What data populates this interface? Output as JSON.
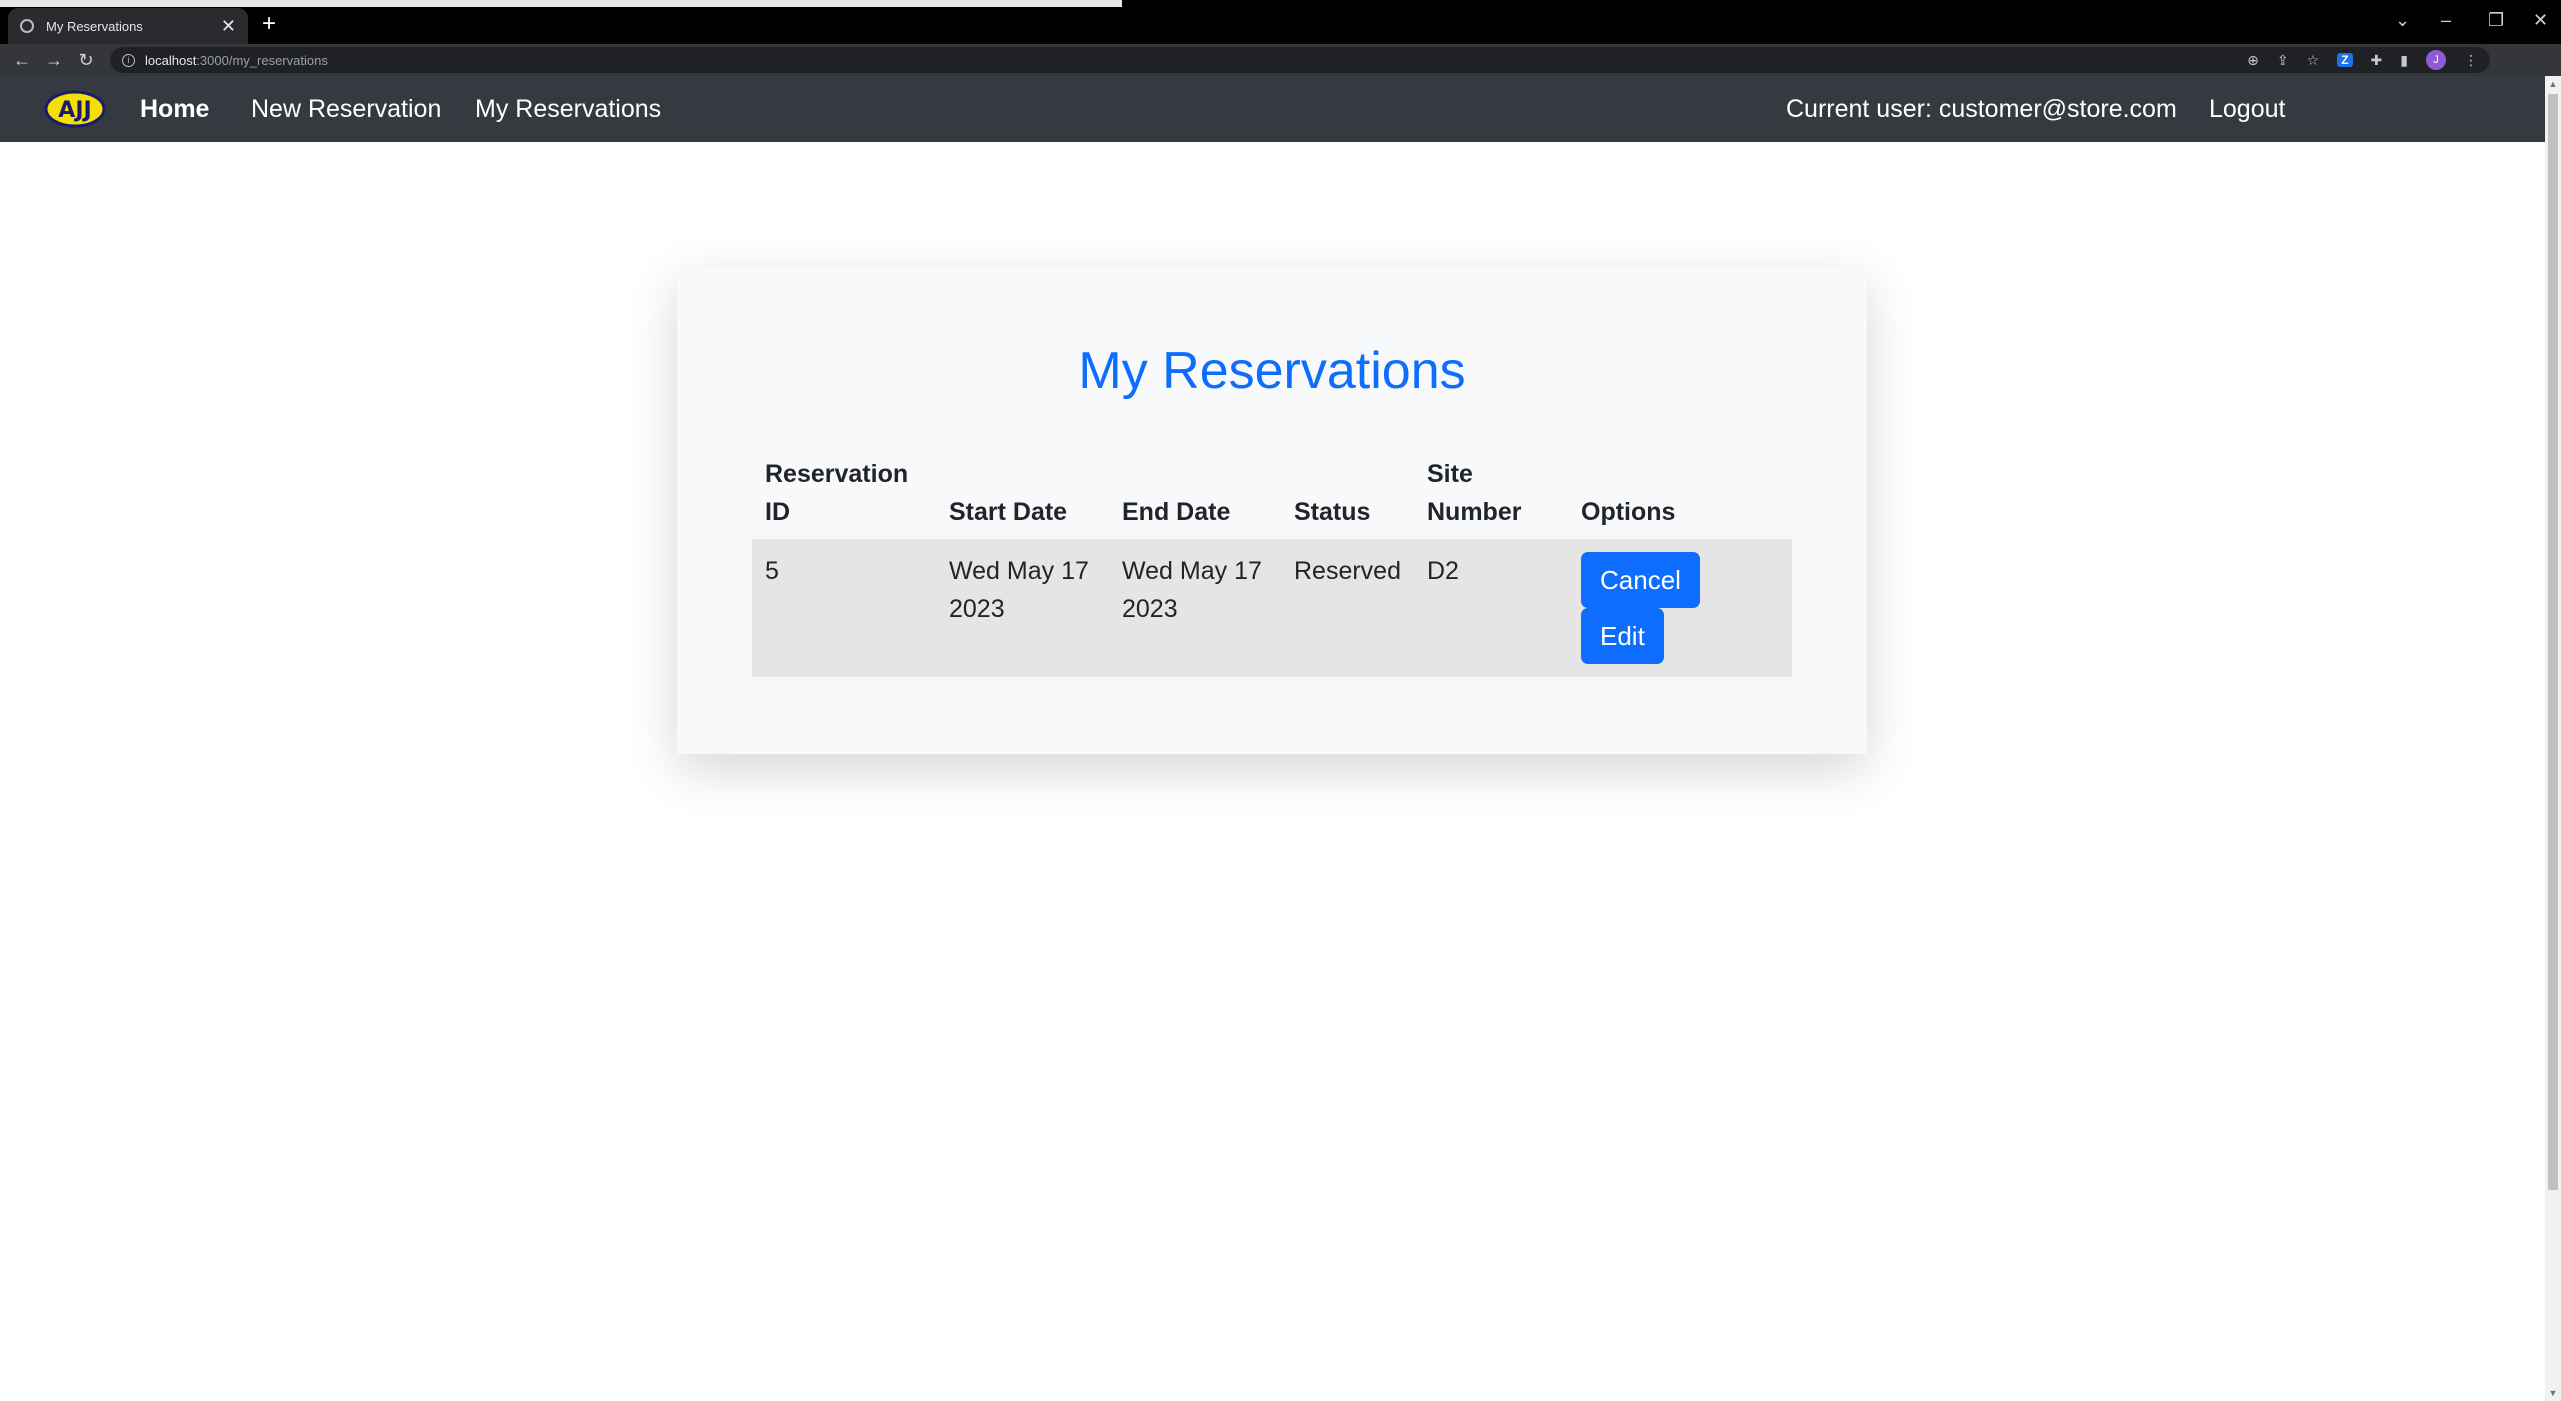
{
  "browser": {
    "tab_title": "My Reservations",
    "tab_close": "✕",
    "new_tab": "+",
    "url_host": "localhost",
    "url_path": ":3000/my_reservations",
    "ext_z": "Z",
    "profile_initial": "J"
  },
  "navbar": {
    "brand": "AJJ",
    "home": "Home",
    "new_reservation": "New Reservation",
    "my_reservations": "My Reservations",
    "current_user": "Current user: customer@store.com",
    "logout": "Logout"
  },
  "page": {
    "title": "My Reservations",
    "table": {
      "headers": {
        "reservation_id": "Reservation ID",
        "start_date": "Start Date",
        "end_date": "End Date",
        "status": "Status",
        "site_number": "Site Number",
        "options": "Options"
      },
      "rows": [
        {
          "reservation_id": "5",
          "start_date": "Wed May 17 2023",
          "end_date": "Wed May 17 2023",
          "status": "Reserved",
          "site_number": "D2",
          "cancel_label": "Cancel",
          "edit_label": "Edit"
        }
      ]
    }
  },
  "colors": {
    "primary": "#0d6efd",
    "navbar_bg": "#343a40",
    "row_bg": "#e5e5e5",
    "card_bg": "#f8f9fa"
  }
}
